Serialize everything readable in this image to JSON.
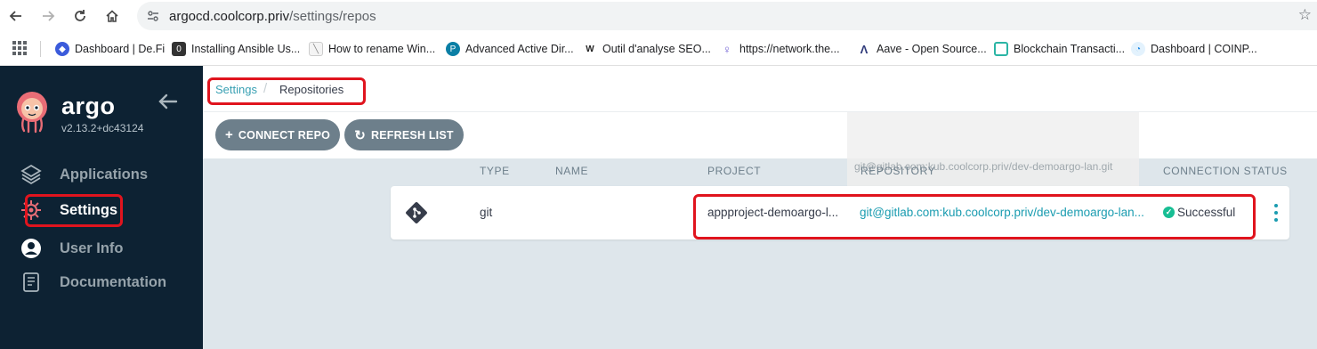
{
  "browser": {
    "url_host": "argocd.coolcorp.priv",
    "url_path": "/settings/repos",
    "bookmarks": [
      {
        "label": "Dashboard | De.Fi",
        "icon": "defi-icon",
        "color": "#3b5bdb"
      },
      {
        "label": "Installing Ansible Us...",
        "icon": "ansible-doc-icon",
        "color": "#333333"
      },
      {
        "label": "How to rename Win...",
        "icon": "page-icon",
        "color": "#9e9e9e"
      },
      {
        "label": "Advanced Active Dir...",
        "icon": "p-circle-icon",
        "color": "#0b7fa5"
      },
      {
        "label": "Outil d'analyse SEO...",
        "icon": "w-logo-icon",
        "color": "#222222"
      },
      {
        "label": "https://network.the...",
        "icon": "network-icon",
        "color": "#6b5bd2"
      },
      {
        "label": "Aave - Open Source...",
        "icon": "aave-icon",
        "color": "#2f3a7a"
      },
      {
        "label": "Blockchain Transacti...",
        "icon": "blockchain-icon",
        "color": "#2bb5a5"
      },
      {
        "label": "Dashboard | COINP...",
        "icon": "coinpaprika-icon",
        "color": "#1e88e5"
      }
    ]
  },
  "sidebar": {
    "brand": "argo",
    "version": "v2.13.2+dc43124",
    "items": [
      {
        "label": "Applications",
        "icon": "layers-icon"
      },
      {
        "label": "Settings",
        "icon": "gear-icon"
      },
      {
        "label": "User Info",
        "icon": "user-icon"
      },
      {
        "label": "Documentation",
        "icon": "book-icon"
      }
    ]
  },
  "breadcrumb": {
    "parent": "Settings",
    "current": "Repositories"
  },
  "toolbar": {
    "connect_label": "CONNECT REPO",
    "refresh_label": "REFRESH LIST"
  },
  "table": {
    "headers": {
      "type": "TYPE",
      "name": "NAME",
      "project": "PROJECT",
      "repository": "REPOSITORY",
      "status": "CONNECTION STATUS"
    },
    "tooltip": "git@gitlab.com:kub.coolcorp.priv/dev-demoargo-lan.git",
    "rows": [
      {
        "type": "git",
        "name": "",
        "project": "appproject-demoargo-l...",
        "repository": "git@gitlab.com:kub.coolcorp.priv/dev-demoargo-lan...",
        "status": "Successful"
      }
    ]
  },
  "colors": {
    "sidebar_bg": "#0d2233",
    "accent": "#1a9cb0",
    "button_bg": "#6d7f8b",
    "success": "#18be94",
    "annotation": "#e0141e"
  }
}
